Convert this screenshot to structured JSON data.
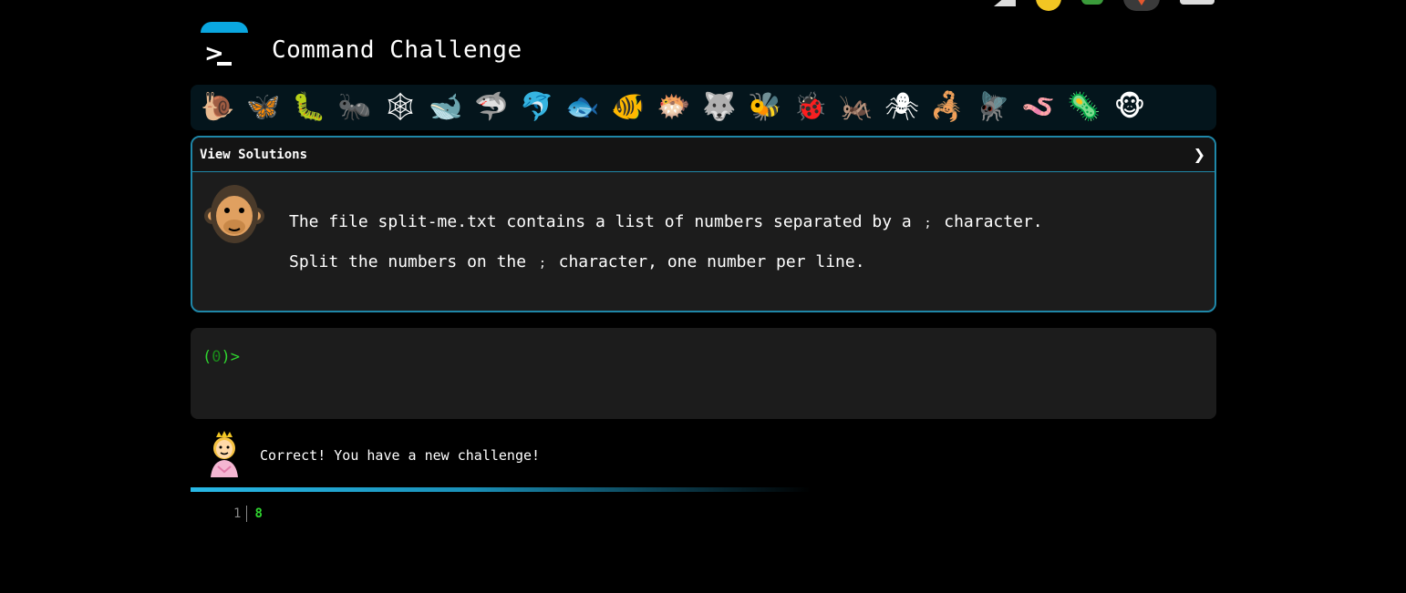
{
  "header": {
    "title": "Command Challenge",
    "logo_icon": "terminal-logo-icon"
  },
  "top_icons": [
    "check-icon",
    "bulb-icon",
    "tree-icon",
    "fox-icon",
    "envelope-icon"
  ],
  "level_icons": [
    {
      "name": "snail",
      "glyph": "🐌"
    },
    {
      "name": "butterfly",
      "glyph": "🦋"
    },
    {
      "name": "caterpillar",
      "glyph": "🐛"
    },
    {
      "name": "ant",
      "glyph": "🐜"
    },
    {
      "name": "spider-web",
      "glyph": "🕸"
    },
    {
      "name": "whale",
      "glyph": "🐋"
    },
    {
      "name": "shark",
      "glyph": "🦈"
    },
    {
      "name": "dolphin",
      "glyph": "🐬"
    },
    {
      "name": "fish",
      "glyph": "🐟"
    },
    {
      "name": "tropical-fish",
      "glyph": "🐠"
    },
    {
      "name": "blowfish",
      "glyph": "🐡"
    },
    {
      "name": "wolf",
      "glyph": "🐺"
    },
    {
      "name": "bee",
      "glyph": "🐝"
    },
    {
      "name": "ladybug",
      "glyph": "🐞"
    },
    {
      "name": "cricket",
      "glyph": "🦗"
    },
    {
      "name": "spider",
      "glyph": "🕷"
    },
    {
      "name": "scorpion",
      "glyph": "🦂"
    },
    {
      "name": "fly",
      "glyph": "🪰"
    },
    {
      "name": "worm",
      "glyph": "🪱"
    },
    {
      "name": "microbe",
      "glyph": "🦠"
    },
    {
      "name": "monkey",
      "glyph": "🐵"
    }
  ],
  "challenge": {
    "view_solutions_label": "View Solutions",
    "expand_glyph": "❯",
    "line1_before": "The file split-me.txt contains a list of numbers separated by a",
    "line1_semi": ";",
    "line1_after": "character.",
    "line2_before": "Split the numbers on the",
    "line2_semi": ";",
    "line2_after": "character, one number per line."
  },
  "terminal": {
    "prompt_open": "(",
    "prompt_code": "0",
    "prompt_close": ")>"
  },
  "feedback": {
    "message": "Correct! You have a new challenge!"
  },
  "output": {
    "line_number": "1",
    "line_text": "8"
  },
  "colors": {
    "accent": "#1f87a8",
    "prompt_green": "#2fd42f",
    "progress": "#28b8e6"
  }
}
